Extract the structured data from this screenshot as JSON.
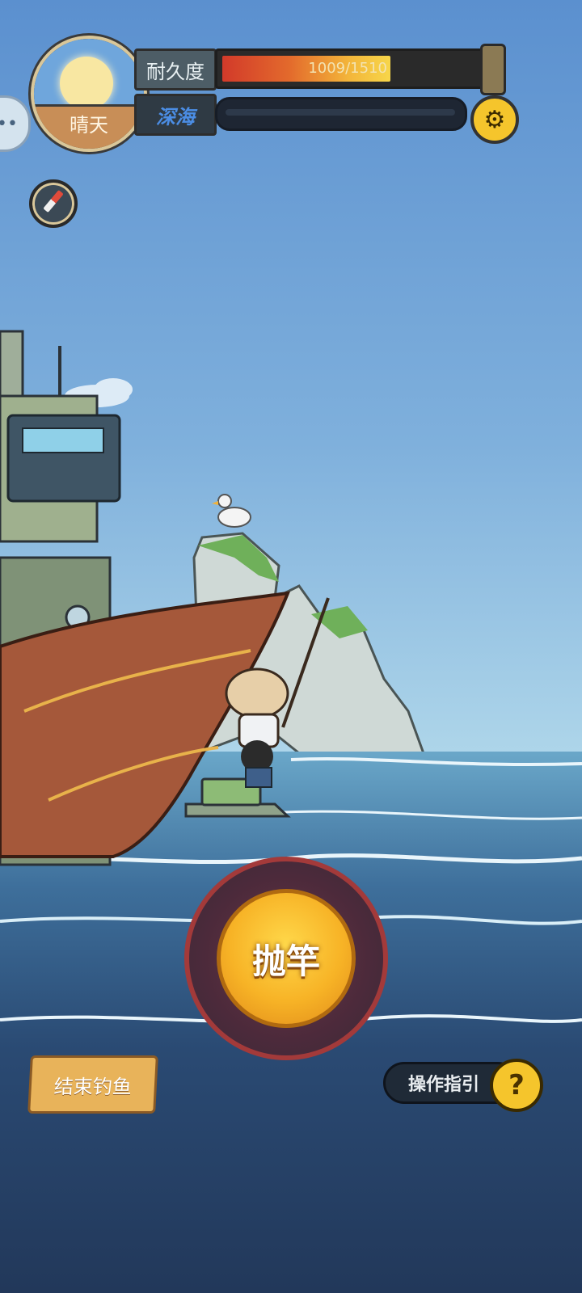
{
  "hud": {
    "weather": "晴天",
    "durability_label": "耐久度",
    "durability_value": "1009/1510",
    "durability_fraction": 0.668,
    "zone_label": "深海",
    "depth_fraction": 0.0
  },
  "actions": {
    "cast_label": "抛竿",
    "end_fishing_label": "结束钓鱼",
    "guide_label": "操作指引",
    "help_symbol": "?"
  },
  "icons": {
    "settings": "gear-icon",
    "compass": "compass-icon",
    "side_menu": "chat-bubble-icon",
    "help": "question-icon"
  },
  "colors": {
    "sky_top": "#5b90cf",
    "sky_bottom": "#9cc8e3",
    "sea": "#24385a",
    "accent_yellow": "#f5c52c"
  }
}
